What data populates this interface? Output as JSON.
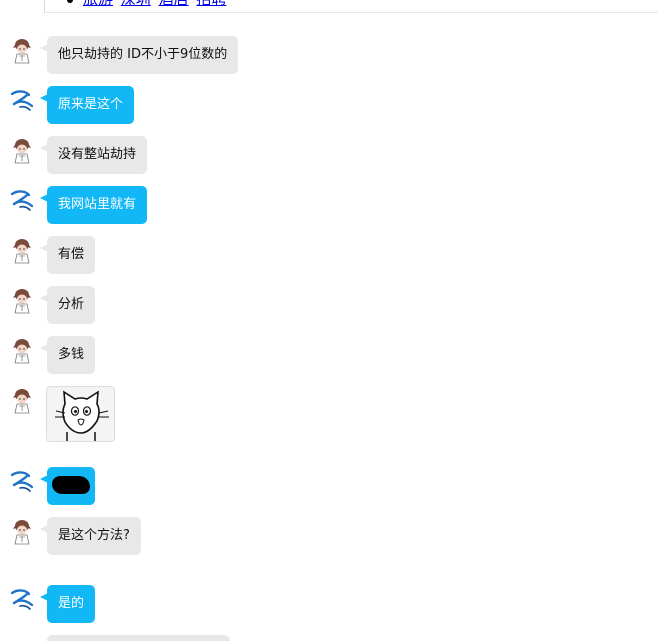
{
  "top_links": [
    "旅游",
    "深圳",
    "酒店",
    "招聘"
  ],
  "messages": [
    {
      "sender": "friend",
      "text": "他只劫持的 ID不小于9位数的"
    },
    {
      "sender": "me",
      "text": "原来是这个"
    },
    {
      "sender": "friend",
      "text": "没有整站劫持"
    },
    {
      "sender": "me",
      "text": "我网站里就有"
    },
    {
      "sender": "friend",
      "text": "有偿"
    },
    {
      "sender": "friend",
      "text": "分析"
    },
    {
      "sender": "friend",
      "text": "多钱"
    },
    {
      "sender": "friend",
      "text": ""
    },
    {
      "sender": "me",
      "text": ""
    },
    {
      "sender": "friend",
      "text": "是这个方法?"
    },
    {
      "sender": "me",
      "text": "是的"
    }
  ],
  "colors": {
    "friend_bubble": "#e8e8e8",
    "my_bubble": "#12b7f5",
    "link": "#0000ee"
  },
  "icons": {
    "friend_avatar": "anime-character-avatar-icon",
    "my_avatar": "blue-swirl-logo-avatar-icon",
    "sticker": "cat-face-sticker",
    "redaction": "black-redaction-scribble"
  }
}
